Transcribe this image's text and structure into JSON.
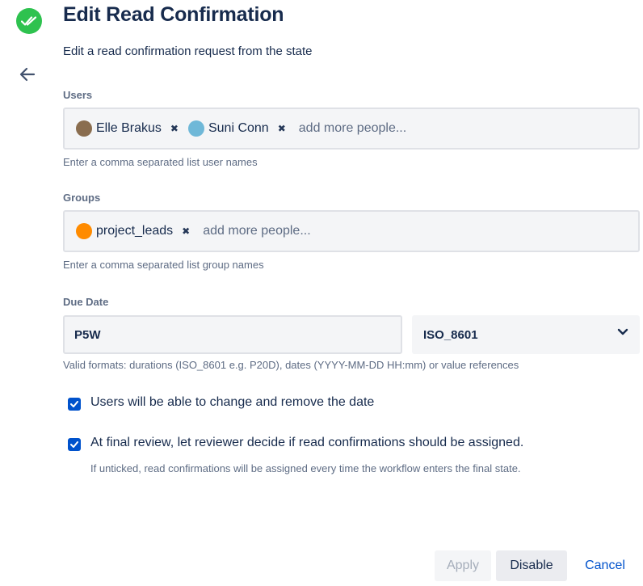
{
  "header": {
    "app_icon": "double-check-icon",
    "title": "Edit Read Confirmation",
    "subtitle": "Edit a read confirmation request from the state",
    "back_icon": "arrow-left-icon"
  },
  "users": {
    "label": "Users",
    "tags": [
      {
        "name": "Elle Brakus",
        "avatar": "user-avatar-icon"
      },
      {
        "name": "Suni Conn",
        "avatar": "user-avatar-icon"
      }
    ],
    "placeholder": "add more people...",
    "help": "Enter a comma separated list user names"
  },
  "groups": {
    "label": "Groups",
    "tags": [
      {
        "name": "project_leads",
        "avatar": "group-avatar-icon"
      }
    ],
    "placeholder": "add more people...",
    "help": "Enter a comma separated list group names"
  },
  "due_date": {
    "label": "Due Date",
    "value": "P5W",
    "format_selected": "ISO_8601",
    "help": "Valid formats: durations (ISO_8601 e.g. P20D), dates (YYYY-MM-DD HH:mm) or value references"
  },
  "options": {
    "change_date": {
      "label": "Users will be able to change and remove the date",
      "checked": true
    },
    "final_review": {
      "label": "At final review, let reviewer decide if read confirmations should be assigned.",
      "help": "If unticked, read confirmations will be assigned every time the workflow enters the final state.",
      "checked": true
    }
  },
  "footer": {
    "apply_label": "Apply",
    "disable_label": "Disable",
    "cancel_label": "Cancel"
  },
  "colors": {
    "accent": "#0052cc",
    "success": "#2ec24f",
    "text": "#172b4d",
    "muted": "#5e6c84"
  }
}
